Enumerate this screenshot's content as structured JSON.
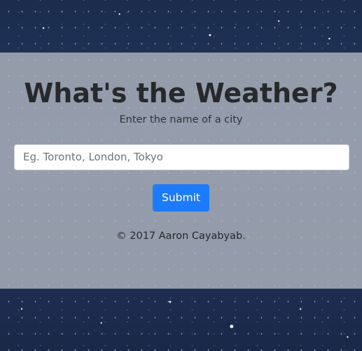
{
  "page": {
    "title": "What's the Weather?",
    "subtitle": "Enter the name of a city"
  },
  "search": {
    "placeholder": "Eg. Toronto, London, Tokyo",
    "value": ""
  },
  "actions": {
    "submit_label": "Submit"
  },
  "footer": {
    "copyright": "© 2017 Aaron Cayabyab."
  },
  "colors": {
    "accent": "#1d7bfa",
    "panel_background": "#b2b7bf",
    "page_background": "#243a62"
  }
}
